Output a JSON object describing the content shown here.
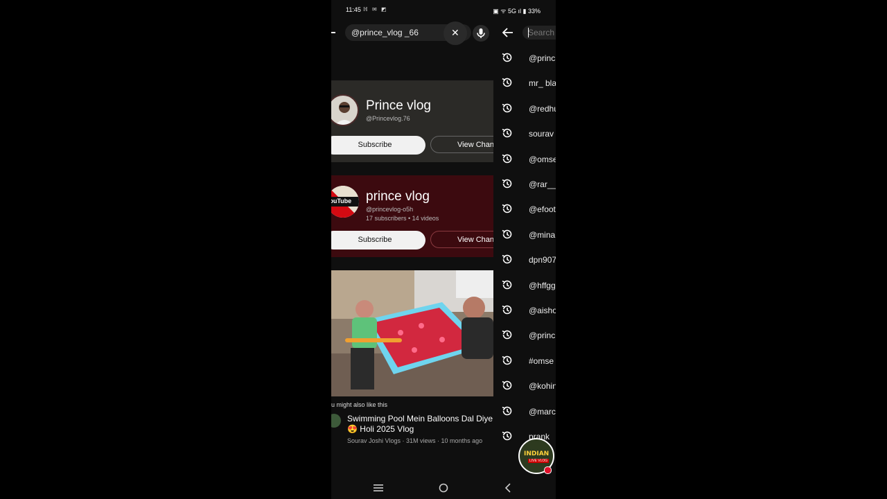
{
  "status_bar": {
    "time": "11:45",
    "icons_left": "ℍ ✉ ◩",
    "right": "▣ ᯤ 5G ıl ▮ 33%"
  },
  "search": {
    "query": "@prince_vlog _66"
  },
  "channels": [
    {
      "name": "Prince vlog",
      "handle": "@Princevlog.76",
      "meta": "",
      "subscribe_label": "Subscribe",
      "view_label": "View Channel"
    },
    {
      "name": "prince vlog",
      "handle": "@princevlog-o5h",
      "meta": "17 subscribers • 14 videos",
      "subscribe_label": "Subscribe",
      "view_label": "View Channel",
      "avatar_text": "YouTube"
    }
  ],
  "recommendation": {
    "section_label": "u might also like this",
    "title_line1": "Swimming Pool Mein Balloons Dal Diye",
    "title_line2": "😍 Holi 2025 Vlog",
    "meta": "Sourav Joshi Vlogs · 31M views · 10 months ago"
  },
  "suggest_panel": {
    "placeholder": "Search",
    "history": [
      "@princ",
      "mr_ bla",
      "@redhu",
      "sourav",
      "@omse",
      "@rar__",
      "@efoot",
      "@mina",
      "dpn907",
      "@hffgg",
      "@aisho",
      "@princ",
      "#omse",
      "@kohin",
      "@marc",
      "prank"
    ]
  },
  "overlay_badge": {
    "line1": "INDIAN",
    "line2": "LIVE VLOG"
  },
  "colors": {
    "card1_bg": "#2b2a27",
    "card2_bg": "#3c0a0f",
    "app_bg": "#0f0f0f"
  }
}
